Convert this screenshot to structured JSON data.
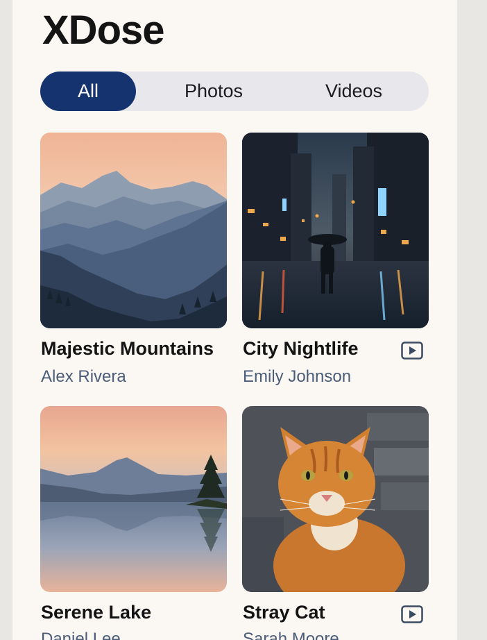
{
  "app": {
    "title": "XDose"
  },
  "filters": {
    "tabs": [
      {
        "label": "All",
        "active": true
      },
      {
        "label": "Photos",
        "active": false
      },
      {
        "label": "Videos",
        "active": false
      }
    ]
  },
  "gallery": {
    "items": [
      {
        "title": "Majestic Mountains",
        "author": "Alex Rivera",
        "media_type": "photo",
        "image": "mountain-landscape"
      },
      {
        "title": "City Nightlife",
        "author": "Emily Johnson",
        "media_type": "video",
        "image": "rainy-city-street"
      },
      {
        "title": "Serene Lake",
        "author": "Daniel Lee",
        "media_type": "photo",
        "image": "lake-reflection"
      },
      {
        "title": "Stray Cat",
        "author": "Sarah Moore",
        "media_type": "video",
        "image": "orange-tabby-cat"
      }
    ]
  },
  "colors": {
    "accent": "#15336e",
    "panel_background": "#fbf8f4",
    "segmented_background": "#e8e8ec",
    "author_text": "#4b5d79"
  },
  "icons": {
    "video_badge": "play-icon"
  }
}
